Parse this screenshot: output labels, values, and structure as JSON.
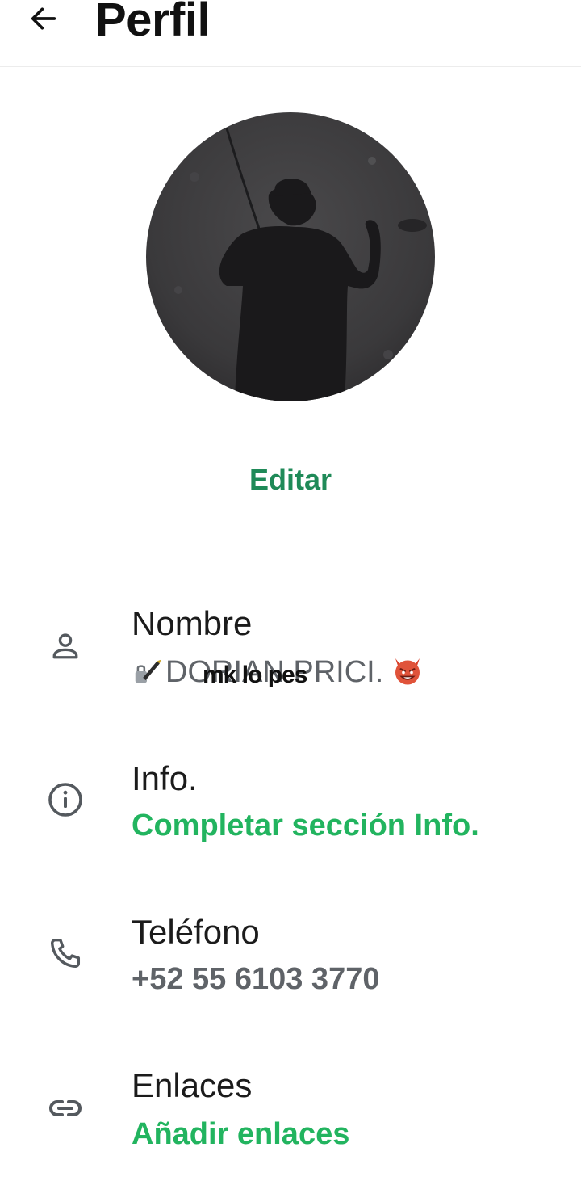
{
  "header": {
    "title": "Perfil",
    "back_icon": "arrow-left-icon"
  },
  "profile": {
    "photo_icon": "profile-photo-shadow",
    "edit_label": "Editar"
  },
  "rows": {
    "name": {
      "icon": "person-icon",
      "label": "Nombre",
      "value": "DORIAN PRICI.",
      "overlay_text": "mk lo pes",
      "emoji_before": "pen-lock-emoji",
      "emoji_after": "devil-emoji"
    },
    "info": {
      "icon": "info-icon",
      "label": "Info.",
      "value": "Completar sección Info."
    },
    "phone": {
      "icon": "phone-icon",
      "label": "Teléfono",
      "value": "+52 55 6103 3770"
    },
    "links": {
      "icon": "link-icon",
      "label": "Enlaces",
      "value": "Añadir enlaces"
    }
  },
  "colors": {
    "accent_green": "#1f8a58",
    "action_green": "#22b45f",
    "secondary_text": "#5f6368",
    "icon_gray": "#54595e"
  }
}
